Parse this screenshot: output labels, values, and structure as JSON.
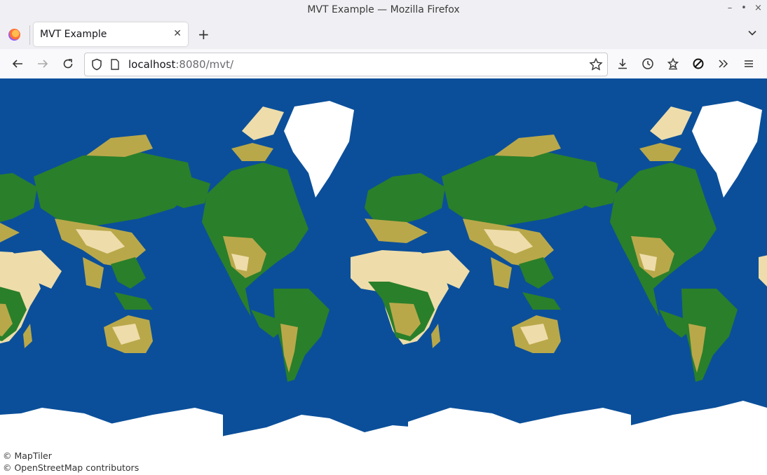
{
  "window": {
    "title": "MVT Example — Mozilla Firefox",
    "controls": [
      "–",
      "•",
      "×"
    ]
  },
  "tabs": [
    {
      "label": "MVT Example",
      "active": true
    }
  ],
  "toolbar": {
    "new_tab": "+",
    "url_host": "localhost",
    "url_rest": ":8080/mvt/"
  },
  "map": {
    "attribution": [
      "© MapTiler",
      "© OpenStreetMap contributors"
    ],
    "colors": {
      "ocean": "#0b4f9a",
      "forest": "#2a7f2a",
      "scrub": "#b9a84a",
      "dry": "#eeddaa",
      "ice": "#ffffff",
      "wetland": "#8a7a30"
    }
  }
}
